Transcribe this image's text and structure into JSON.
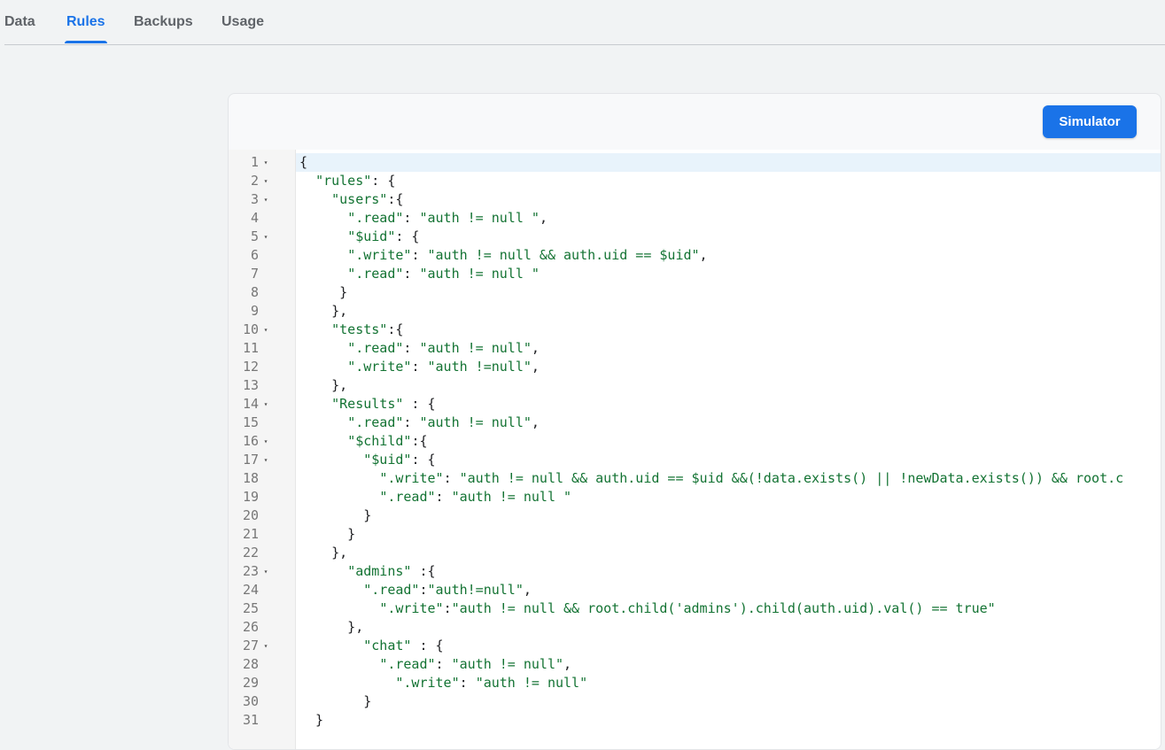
{
  "tabs": [
    {
      "label": "Data",
      "active": false
    },
    {
      "label": "Rules",
      "active": true
    },
    {
      "label": "Backups",
      "active": false
    },
    {
      "label": "Usage",
      "active": false
    }
  ],
  "toolbar": {
    "simulator_label": "Simulator"
  },
  "colors": {
    "accent": "#1a73e8",
    "string": "#137333",
    "current_line": "#e8f3fb"
  },
  "editor": {
    "current_line": 1,
    "lines": [
      {
        "n": "1",
        "fold": true,
        "text": "{"
      },
      {
        "n": "2",
        "fold": true,
        "text": "  \"rules\": {"
      },
      {
        "n": "3",
        "fold": true,
        "text": "    \"users\":{"
      },
      {
        "n": "4",
        "fold": false,
        "text": "      \".read\": \"auth != null \","
      },
      {
        "n": "5",
        "fold": true,
        "text": "      \"$uid\": {"
      },
      {
        "n": "6",
        "fold": false,
        "text": "      \".write\": \"auth != null && auth.uid == $uid\","
      },
      {
        "n": "7",
        "fold": false,
        "text": "      \".read\": \"auth != null \""
      },
      {
        "n": "8",
        "fold": false,
        "text": "     }"
      },
      {
        "n": "9",
        "fold": false,
        "text": "    },"
      },
      {
        "n": "10",
        "fold": true,
        "text": "    \"tests\":{"
      },
      {
        "n": "11",
        "fold": false,
        "text": "      \".read\": \"auth != null\","
      },
      {
        "n": "12",
        "fold": false,
        "text": "      \".write\": \"auth !=null\","
      },
      {
        "n": "13",
        "fold": false,
        "text": "    },"
      },
      {
        "n": "14",
        "fold": true,
        "text": "    \"Results\" : {"
      },
      {
        "n": "15",
        "fold": false,
        "text": "      \".read\": \"auth != null\","
      },
      {
        "n": "16",
        "fold": true,
        "text": "      \"$child\":{"
      },
      {
        "n": "17",
        "fold": true,
        "text": "        \"$uid\": {"
      },
      {
        "n": "18",
        "fold": false,
        "text": "          \".write\": \"auth != null && auth.uid == $uid &&(!data.exists() || !newData.exists()) && root.c"
      },
      {
        "n": "19",
        "fold": false,
        "text": "          \".read\": \"auth != null \""
      },
      {
        "n": "20",
        "fold": false,
        "text": "        }"
      },
      {
        "n": "21",
        "fold": false,
        "text": "      }"
      },
      {
        "n": "22",
        "fold": false,
        "text": "    },"
      },
      {
        "n": "23",
        "fold": true,
        "text": "      \"admins\" :{"
      },
      {
        "n": "24",
        "fold": false,
        "text": "        \".read\":\"auth!=null\","
      },
      {
        "n": "25",
        "fold": false,
        "text": "          \".write\":\"auth != null && root.child('admins').child(auth.uid).val() == true\""
      },
      {
        "n": "26",
        "fold": false,
        "text": "      },"
      },
      {
        "n": "27",
        "fold": true,
        "text": "        \"chat\" : {"
      },
      {
        "n": "28",
        "fold": false,
        "text": "          \".read\": \"auth != null\","
      },
      {
        "n": "29",
        "fold": false,
        "text": "            \".write\": \"auth != null\""
      },
      {
        "n": "30",
        "fold": false,
        "text": "        }"
      },
      {
        "n": "31",
        "fold": false,
        "text": "  }"
      }
    ]
  }
}
